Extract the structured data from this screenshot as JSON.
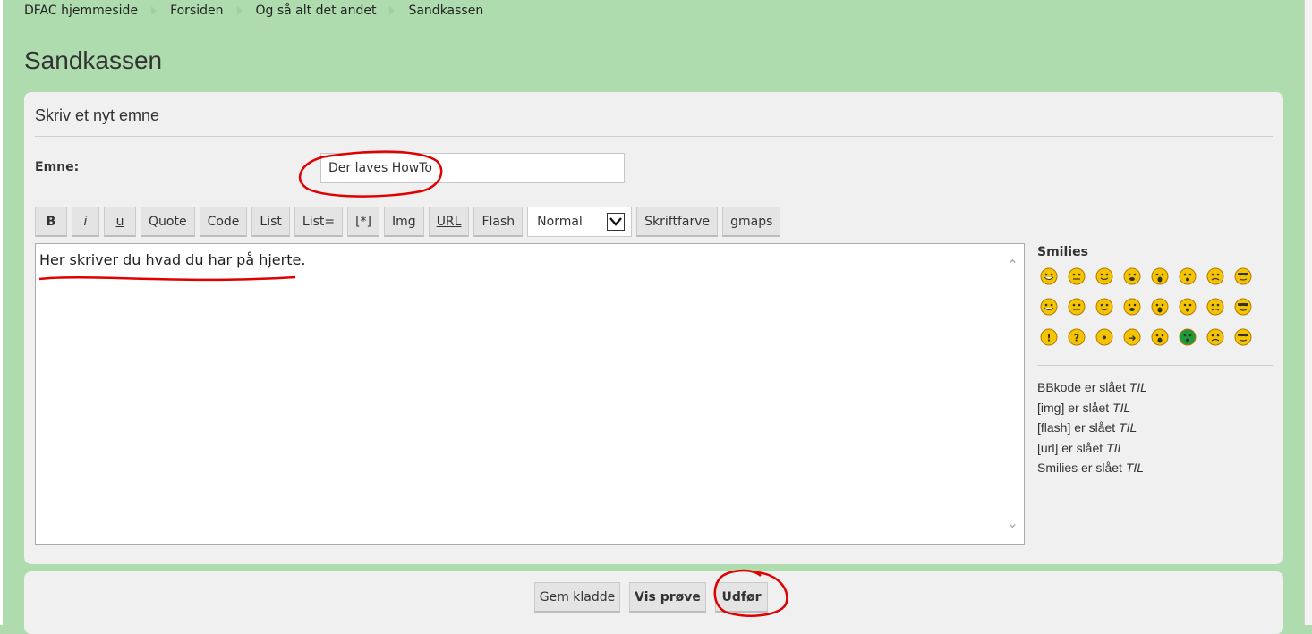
{
  "breadcrumb": [
    "DFAC hjemmeside",
    "Forsiden",
    "Og så alt det andet",
    "Sandkassen"
  ],
  "page_title": "Sandkassen",
  "form": {
    "heading": "Skriv et nyt emne",
    "subject_label": "Emne:",
    "subject_value": "Der laves HowTo",
    "message_text": "Her skriver du hvad du har på hjerte."
  },
  "toolbar": {
    "bold": "B",
    "italic": "i",
    "underline": "u",
    "quote": "Quote",
    "code": "Code",
    "list": "List",
    "list_eq": "List=",
    "list_item": "[*]",
    "img": "Img",
    "url": "URL",
    "flash": "Flash",
    "size_select": "Normal",
    "font_color": "Skriftfarve",
    "gmaps": "gmaps"
  },
  "smilies": {
    "title": "Smilies",
    "icons": [
      "grin-icon",
      "neutral-icon",
      "smile-icon",
      "eek-icon",
      "surprised-icon",
      "shock-icon",
      "confused-icon",
      "cool-icon",
      "laugh-icon",
      "mad-icon",
      "razz-icon",
      "redface-icon",
      "cry-icon",
      "evil-icon",
      "twisted-icon",
      "rolleyes-icon",
      "exclaim-icon",
      "question-icon",
      "idea-icon",
      "arrow-icon",
      "neutral-face-icon",
      "green-grin-icon",
      "geek-icon",
      "nerd-icon"
    ]
  },
  "status_notes": [
    {
      "text": "BBkode er slået",
      "state": "TIL"
    },
    {
      "text": "[img] er slået",
      "state": "TIL"
    },
    {
      "text": "[flash] er slået",
      "state": "TIL"
    },
    {
      "text": "[url] er slået",
      "state": "TIL"
    },
    {
      "text": "Smilies er slået",
      "state": "TIL"
    }
  ],
  "actions": {
    "save_draft": "Gem kladde",
    "preview": "Vis prøve",
    "submit": "Udfør"
  },
  "colors": {
    "page_bg": "#aedcae",
    "panel_bg": "#f0f0f0",
    "smiley_yellow": "#f5c400",
    "smiley_green": "#1e9a3a",
    "annotation_red": "#e00000"
  }
}
